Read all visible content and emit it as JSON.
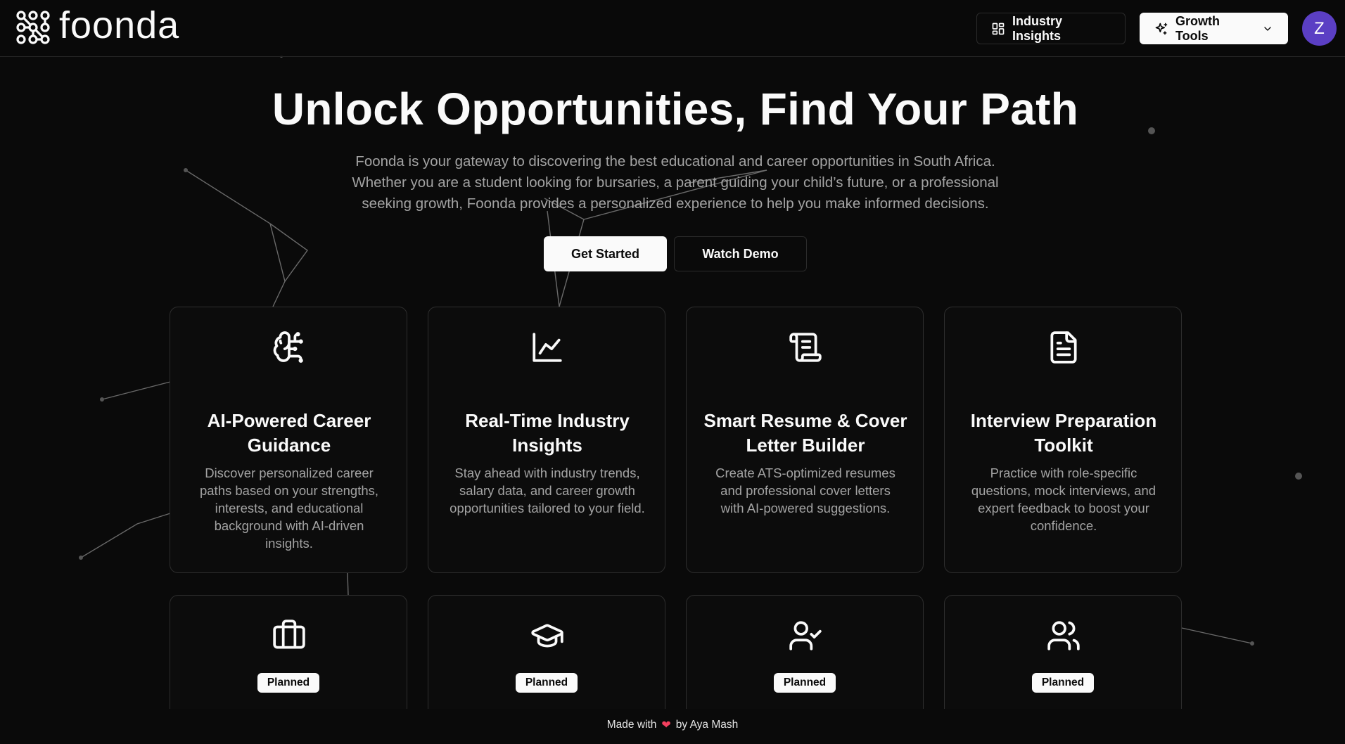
{
  "header": {
    "logo_text": "foonda",
    "industry_insights_label": "Industry Insights",
    "growth_tools_label": "Growth Tools",
    "avatar_initial": "Z"
  },
  "hero": {
    "title": "Unlock Opportunities, Find Your Path",
    "description": "Foonda is your gateway to discovering the best educational and career opportunities in South Africa. Whether you are a student looking for bursaries, a parent guiding your child’s future, or a professional seeking growth, Foonda provides a personalized experience to help you make informed decisions.",
    "get_started_label": "Get Started",
    "watch_demo_label": "Watch Demo"
  },
  "features": [
    {
      "icon": "brain-circuit-icon",
      "title": "AI-Powered Career Guidance",
      "description": "Discover personalized career paths based on your strengths, interests, and educational background with AI-driven insights."
    },
    {
      "icon": "line-chart-icon",
      "title": "Real-Time Industry Insights",
      "description": "Stay ahead with industry trends, salary data, and career growth opportunities tailored to your field."
    },
    {
      "icon": "scroll-icon",
      "title": "Smart Resume & Cover Letter Builder",
      "description": "Create ATS-optimized resumes and professional cover letters with AI-powered suggestions."
    },
    {
      "icon": "file-text-icon",
      "title": "Interview Preparation Toolkit",
      "description": "Practice with role-specific questions, mock interviews, and expert feedback to boost your confidence."
    }
  ],
  "planned_features": [
    {
      "icon": "briefcase-icon",
      "badge": "Planned"
    },
    {
      "icon": "graduation-cap-icon",
      "badge": "Planned"
    },
    {
      "icon": "user-check-icon",
      "badge": "Planned"
    },
    {
      "icon": "users-icon",
      "badge": "Planned"
    }
  ],
  "footer": {
    "made_with": "Made with",
    "heart": "❤",
    "by": "by Aya Mash"
  },
  "colors": {
    "background": "#0a0a0a",
    "avatar": "#5b3fc4",
    "heart": "#f43f5e"
  }
}
